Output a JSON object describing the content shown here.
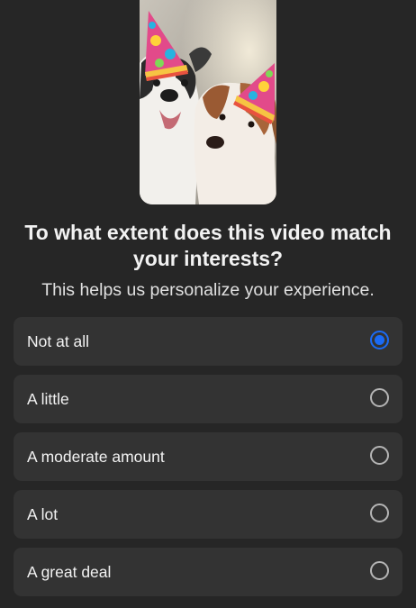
{
  "video": {
    "thumbnail_icon": "dogs-party-hats-image"
  },
  "question": {
    "title": "To what extent does this video match your interests?",
    "subtitle": "This helps us personalize your experience."
  },
  "options": [
    {
      "label": "Not at all",
      "selected": true
    },
    {
      "label": "A little",
      "selected": false
    },
    {
      "label": "A moderate amount",
      "selected": false
    },
    {
      "label": "A lot",
      "selected": false
    },
    {
      "label": "A great deal",
      "selected": false
    }
  ],
  "colors": {
    "background": "#262626",
    "option_background": "#333333",
    "accent": "#1b6bf5"
  }
}
